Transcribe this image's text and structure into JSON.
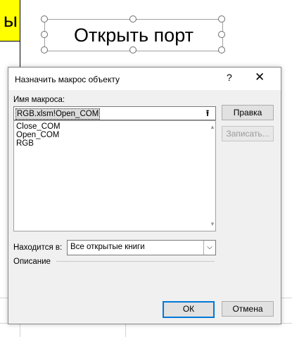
{
  "background": {
    "yellow_cell_text": "ы",
    "shape_label": "Открыть порт"
  },
  "dialog": {
    "title": "Назначить макрос объекту",
    "help_glyph": "?",
    "close_glyph": "✕",
    "macro_name_label": "Имя макроса:",
    "macro_name_value": "RGB.xlsm!Open_COM",
    "macros": [
      "Close_COM",
      "Open_COM",
      "RGB"
    ],
    "edit_button": "Правка",
    "record_button": "Записать...",
    "location_label": "Находится в:",
    "location_value": "Все открытые книги",
    "description_label": "Описание",
    "ok_button": "ОК",
    "cancel_button": "Отмена"
  },
  "colors": {
    "highlight_cell": "#ffff00",
    "default_button_border": "#0078d7"
  }
}
